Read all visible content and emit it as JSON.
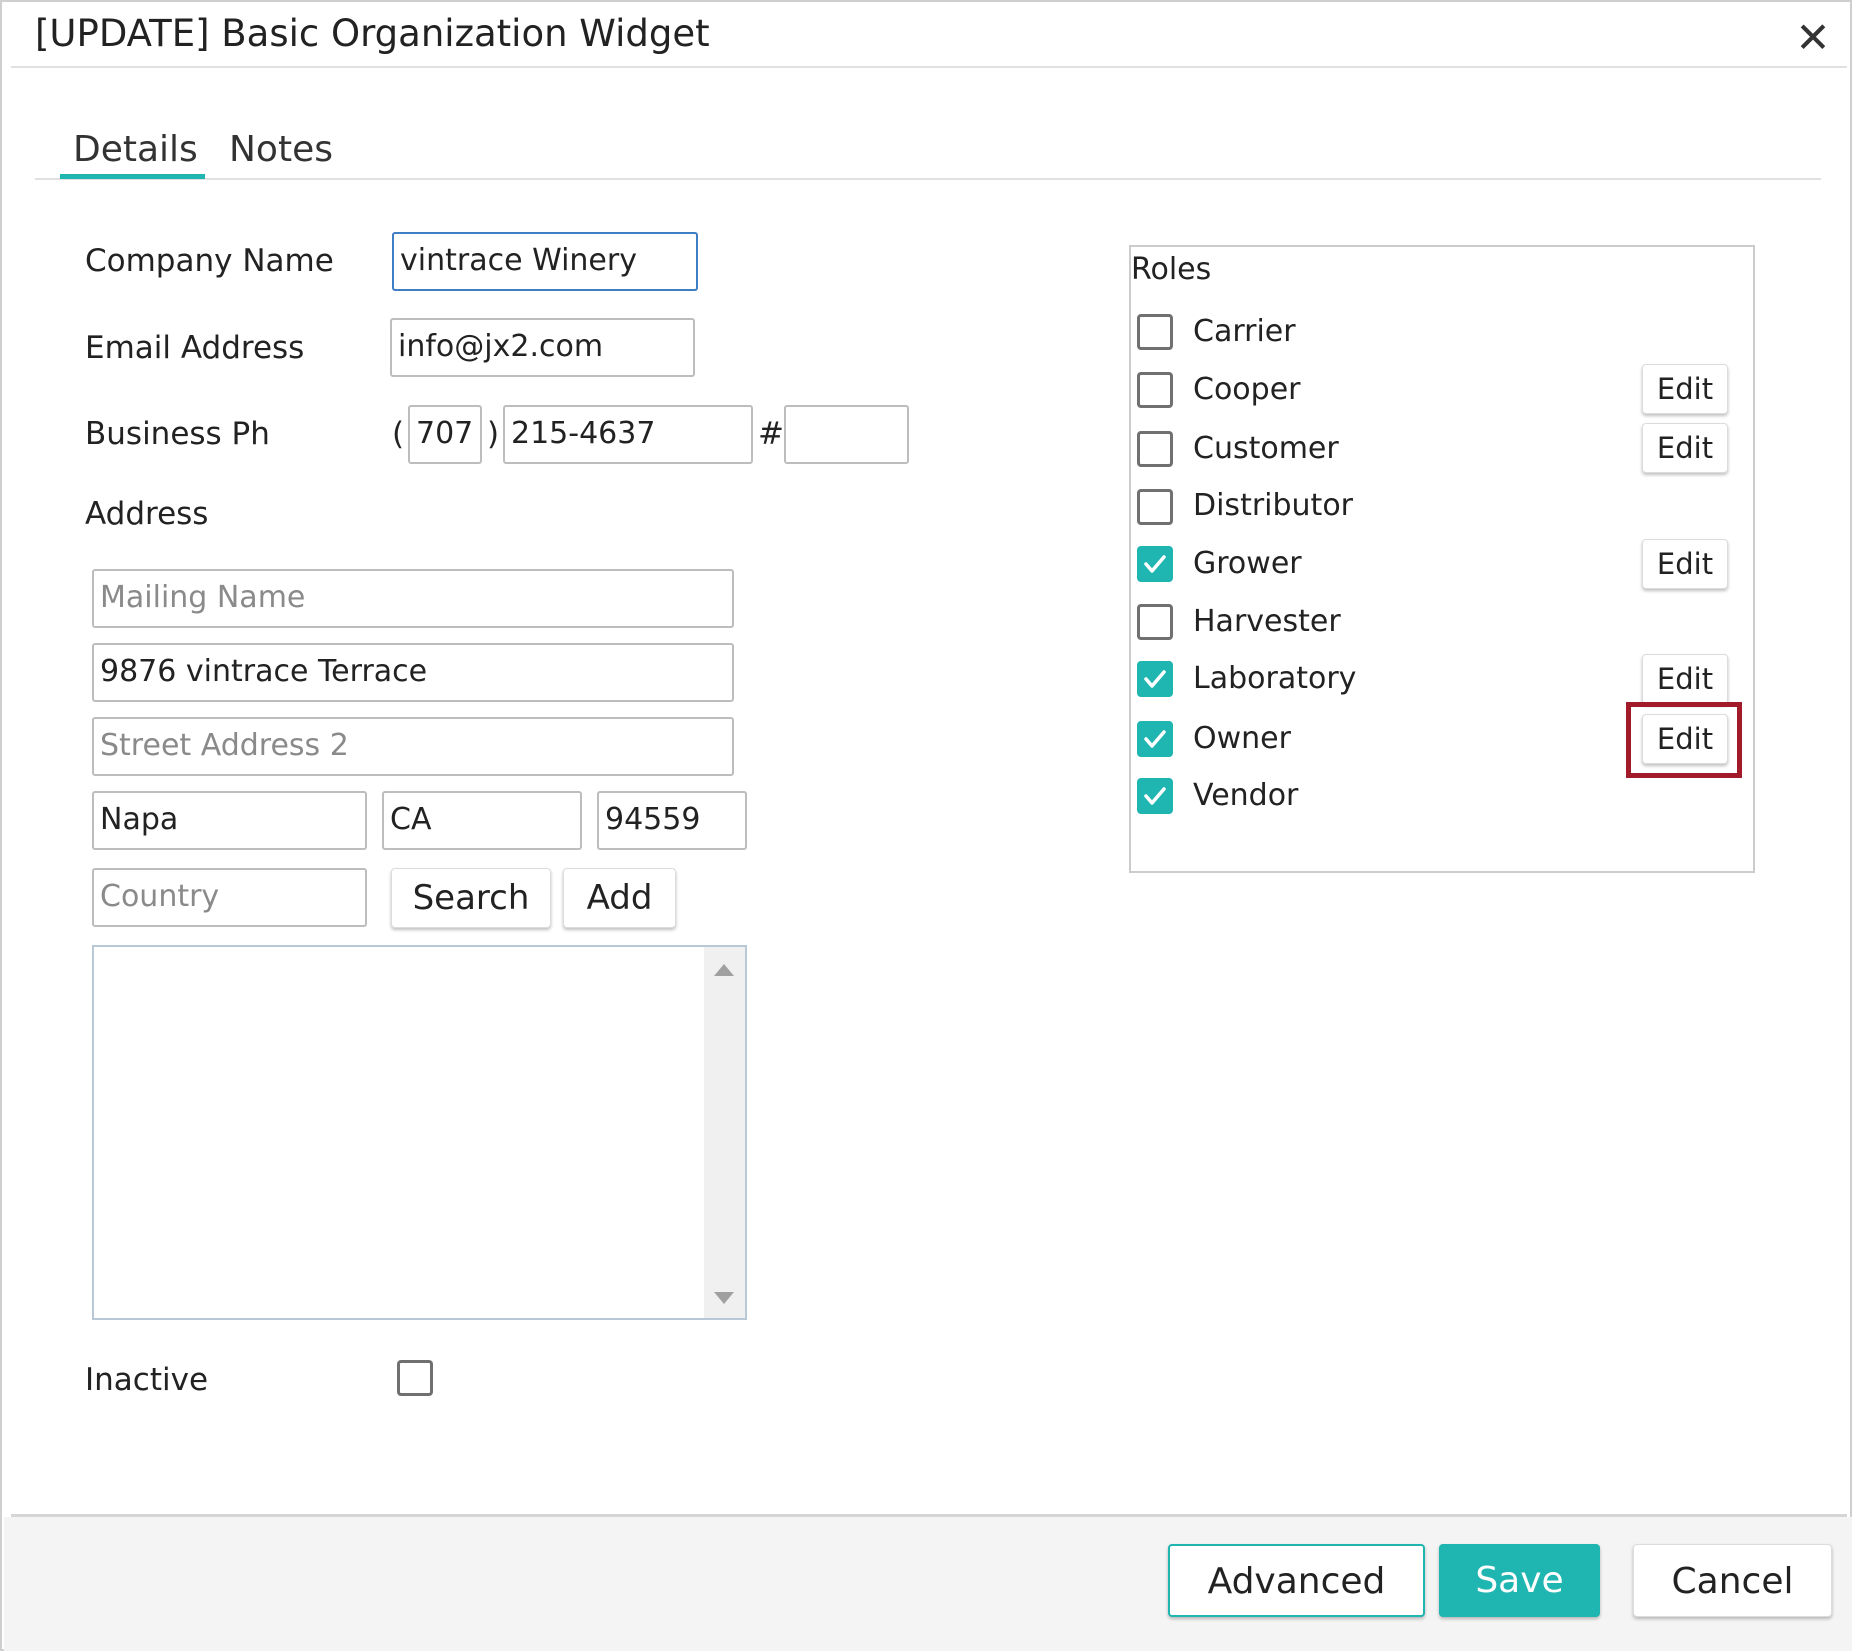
{
  "dialog": {
    "title": "[UPDATE] Basic Organization Widget",
    "close_glyph": "✕"
  },
  "tabs": [
    {
      "label": "Details",
      "active": true
    },
    {
      "label": "Notes",
      "active": false
    }
  ],
  "form": {
    "company_name_label": "Company Name",
    "company_name_value": "vintrace Winery",
    "email_label": "Email Address",
    "email_value": "info@jx2.com",
    "phone_label": "Business Ph",
    "phone_open_paren": "(",
    "phone_area_code": "707",
    "phone_close_paren": ")",
    "phone_number": "215-4637",
    "phone_ext_symbol": "#",
    "phone_ext": "",
    "address_label": "Address",
    "mailing_name_placeholder": "Mailing Name",
    "street1_value": "9876 vintrace Terrace",
    "street2_placeholder": "Street Address 2",
    "city_value": "Napa",
    "state_value": "CA",
    "zip_value": "94559",
    "country_placeholder": "Country",
    "search_button": "Search",
    "add_button": "Add",
    "inactive_label": "Inactive",
    "inactive_checked": false
  },
  "roles": {
    "title": "Roles",
    "edit_label": "Edit",
    "items": [
      {
        "label": "Carrier",
        "checked": false,
        "has_edit": false
      },
      {
        "label": "Cooper",
        "checked": false,
        "has_edit": true
      },
      {
        "label": "Customer",
        "checked": false,
        "has_edit": true
      },
      {
        "label": "Distributor",
        "checked": false,
        "has_edit": false
      },
      {
        "label": "Grower",
        "checked": true,
        "has_edit": true
      },
      {
        "label": "Harvester",
        "checked": false,
        "has_edit": false
      },
      {
        "label": "Laboratory",
        "checked": true,
        "has_edit": true
      },
      {
        "label": "Owner",
        "checked": true,
        "has_edit": true
      },
      {
        "label": "Vendor",
        "checked": true,
        "has_edit": false
      }
    ]
  },
  "footer": {
    "advanced_button": "Advanced",
    "save_button": "Save",
    "cancel_button": "Cancel"
  },
  "colors": {
    "accent": "#1fb5b0",
    "highlight": "#a21b2b",
    "focus_border": "#3f7dc4"
  },
  "icons": {
    "close": "close-icon",
    "check": "check-icon",
    "scroll_up": "scroll-up-arrow-icon",
    "scroll_down": "scroll-down-arrow-icon"
  }
}
